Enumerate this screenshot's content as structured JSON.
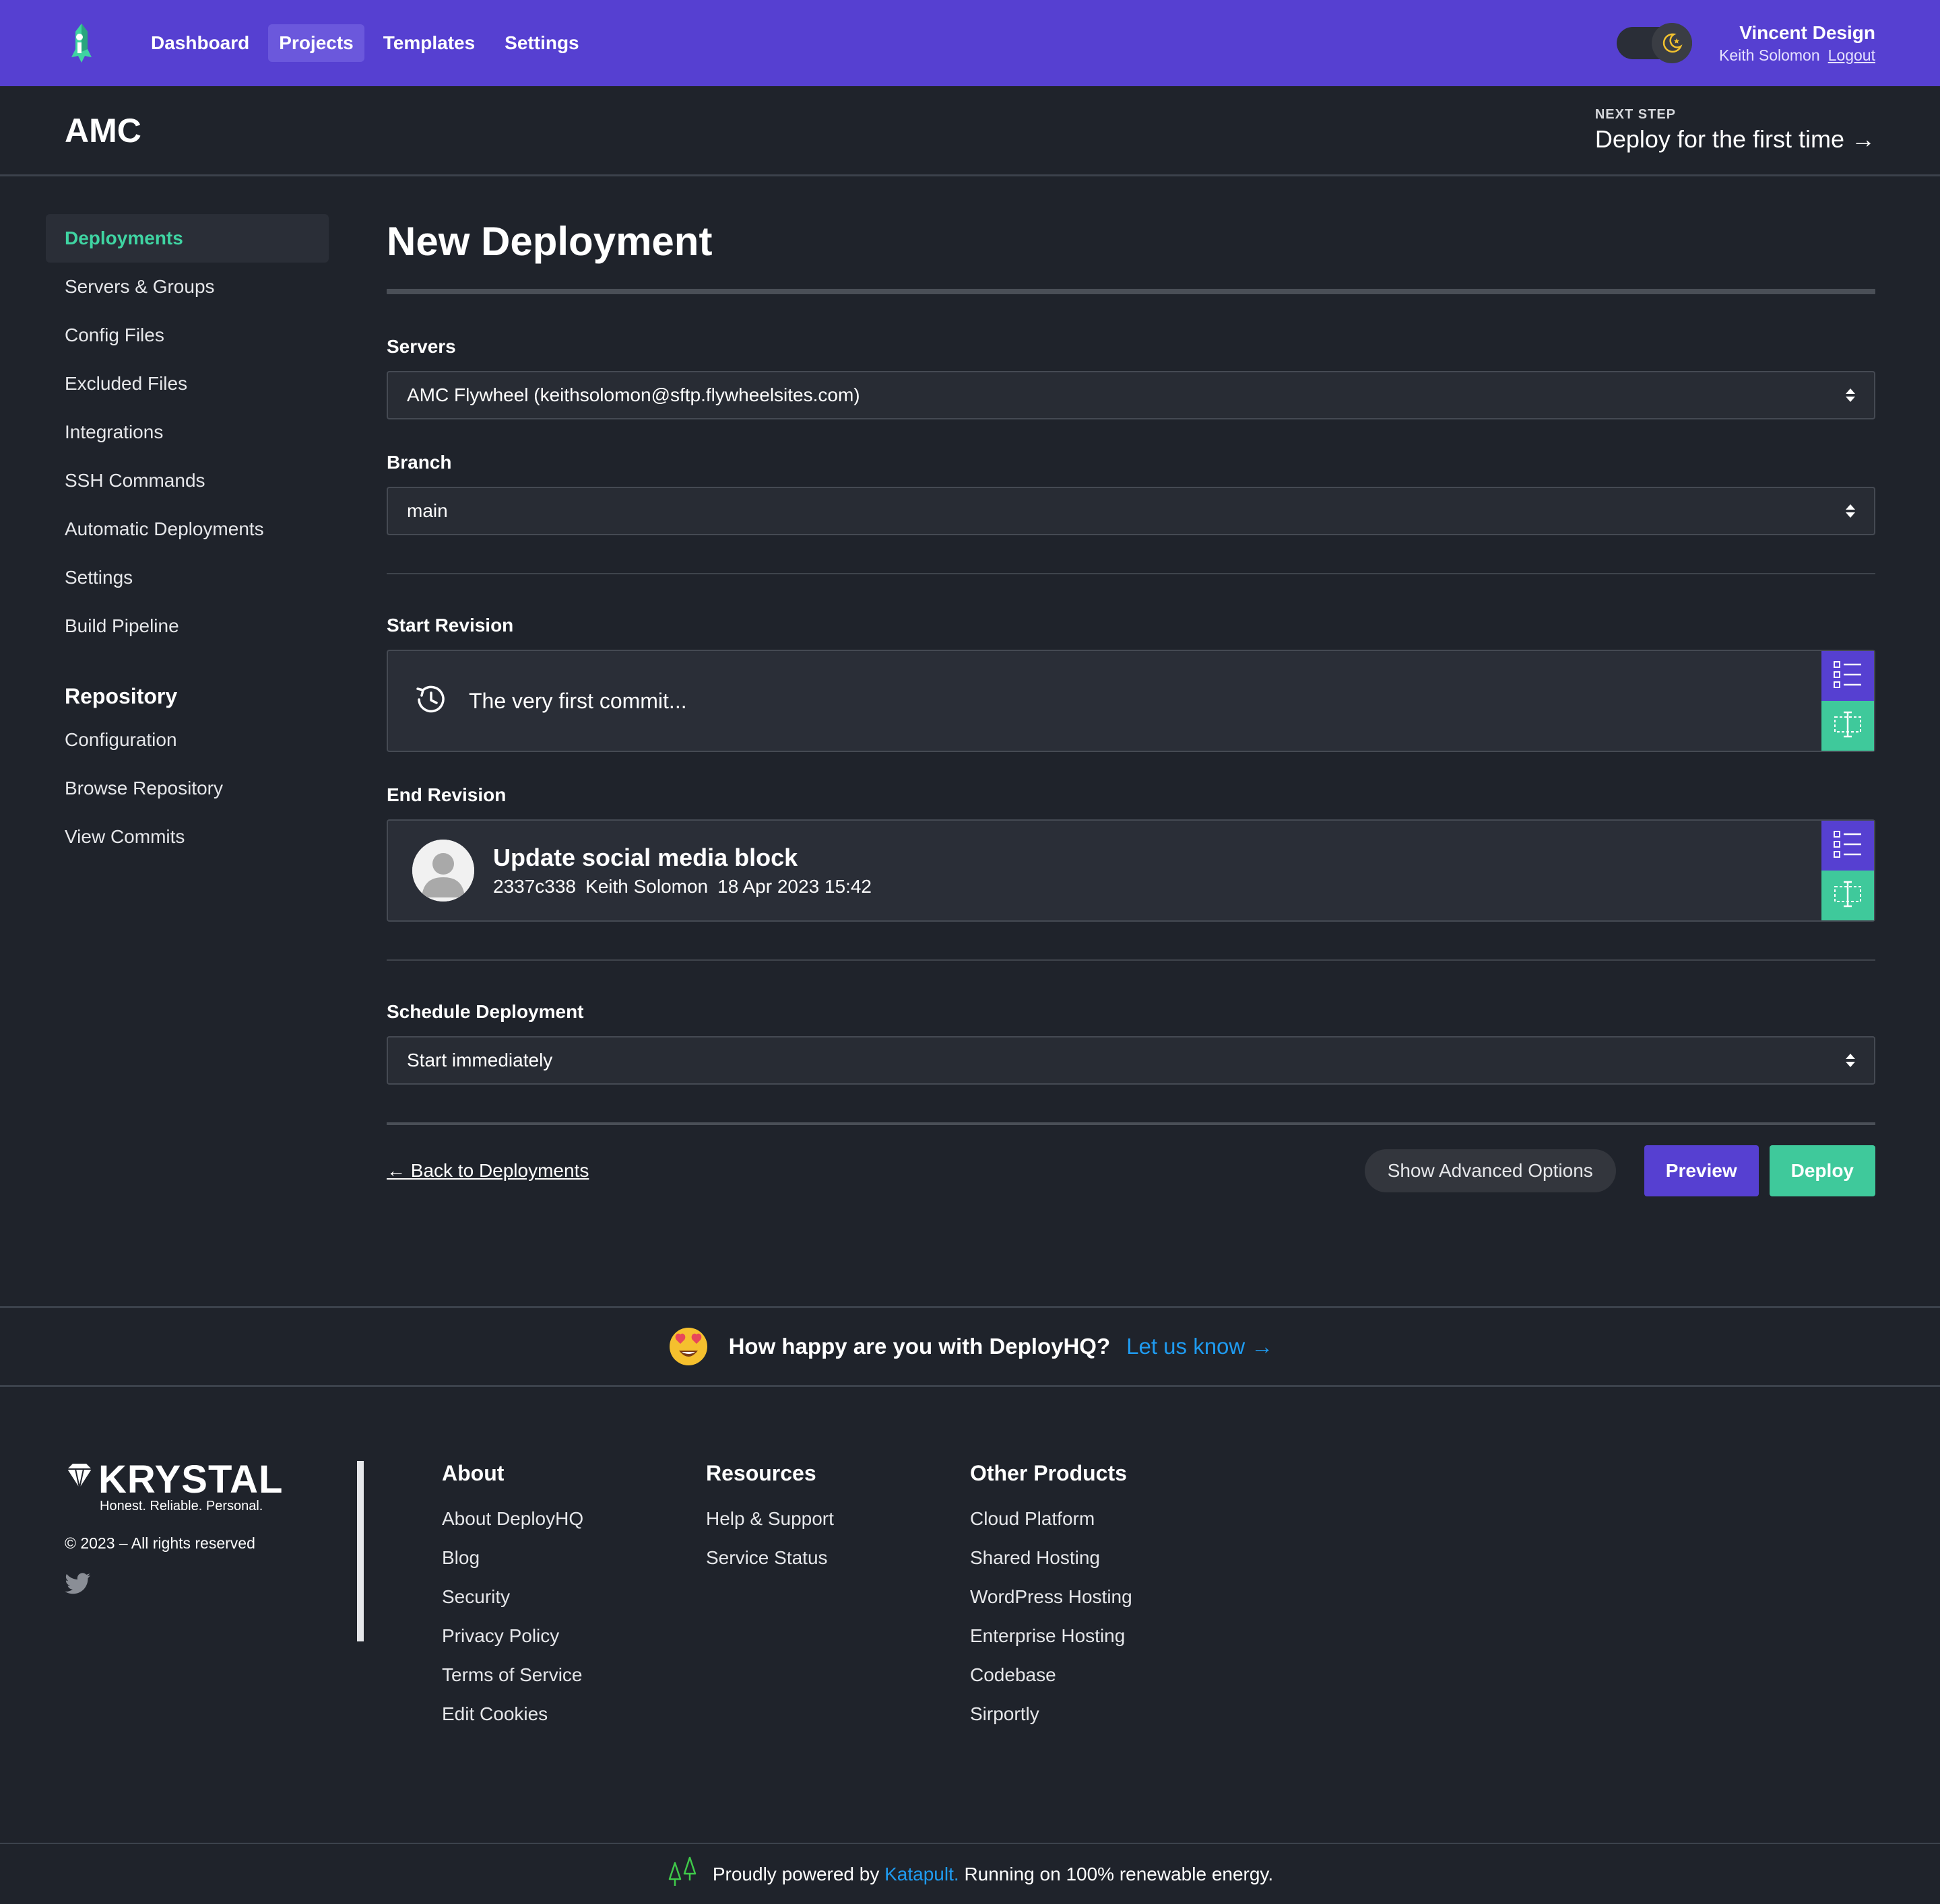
{
  "topnav": {
    "items": [
      {
        "label": "Dashboard",
        "active": false
      },
      {
        "label": "Projects",
        "active": true
      },
      {
        "label": "Templates",
        "active": false
      },
      {
        "label": "Settings",
        "active": false
      }
    ],
    "company": "Vincent Design",
    "user": "Keith Solomon",
    "logout": "Logout"
  },
  "project": {
    "title": "AMC",
    "next_step_label": "NEXT STEP",
    "next_step_link": "Deploy for the first time →"
  },
  "sidebar": {
    "items": [
      {
        "label": "Deployments",
        "active": true
      },
      {
        "label": "Servers & Groups"
      },
      {
        "label": "Config Files"
      },
      {
        "label": "Excluded Files"
      },
      {
        "label": "Integrations"
      },
      {
        "label": "SSH Commands"
      },
      {
        "label": "Automatic Deployments"
      },
      {
        "label": "Settings"
      },
      {
        "label": "Build Pipeline"
      }
    ],
    "repo_heading": "Repository",
    "repo_items": [
      {
        "label": "Configuration"
      },
      {
        "label": "Browse Repository"
      },
      {
        "label": "View Commits"
      }
    ]
  },
  "form": {
    "title": "New Deployment",
    "servers_label": "Servers",
    "servers_value": "AMC Flywheel (keithsolomon@sftp.flywheelsites.com)",
    "branch_label": "Branch",
    "branch_value": "main",
    "start_label": "Start Revision",
    "start_value": "The very first commit...",
    "end_label": "End Revision",
    "end_commit": {
      "title": "Update social media block",
      "hash": "2337c338",
      "author": "Keith Solomon",
      "date": "18 Apr 2023 15:42"
    },
    "schedule_label": "Schedule Deployment",
    "schedule_value": "Start immediately",
    "back_link": "← Back to Deployments",
    "advanced_button": "Show Advanced Options",
    "preview_button": "Preview",
    "deploy_button": "Deploy"
  },
  "feedback": {
    "question": "How happy are you with DeployHQ?",
    "link": "Let us know →"
  },
  "footer": {
    "brand": "KRYSTAL",
    "tagline": "Honest. Reliable. Personal.",
    "copyright": "© 2023 – All rights reserved",
    "columns": [
      {
        "heading": "About",
        "links": [
          "About DeployHQ",
          "Blog",
          "Security",
          "Privacy Policy",
          "Terms of Service",
          "Edit Cookies"
        ]
      },
      {
        "heading": "Resources",
        "links": [
          "Help & Support",
          "Service Status"
        ]
      },
      {
        "heading": "Other Products",
        "links": [
          "Cloud Platform",
          "Shared Hosting",
          "WordPress Hosting",
          "Enterprise Hosting",
          "Codebase",
          "Sirportly"
        ]
      }
    ],
    "powered_prefix": "Proudly powered by",
    "powered_link": "Katapult.",
    "powered_suffix": "Running on 100% renewable energy."
  },
  "colors": {
    "nav_purple": "#5640d1",
    "accent_green": "#3fc99b",
    "background": "#1f232b",
    "link_blue": "#1f9bf0"
  }
}
